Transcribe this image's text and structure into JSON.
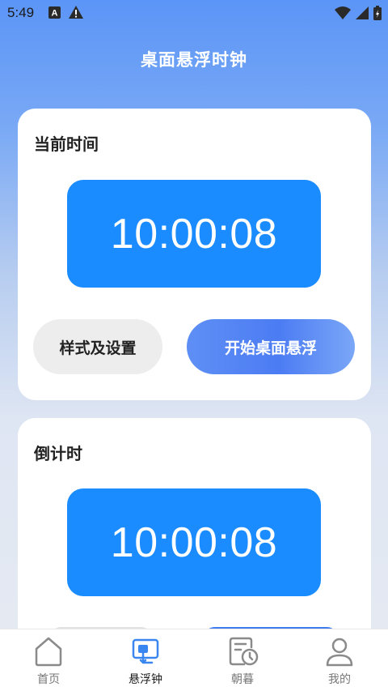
{
  "status_bar": {
    "time": "5:49",
    "left_icons": [
      "a-box-icon",
      "warning-icon"
    ],
    "right_icons": [
      "wifi-icon",
      "signal-icon",
      "battery-icon"
    ]
  },
  "app": {
    "title": "桌面悬浮时钟"
  },
  "current_time_card": {
    "title": "当前时间",
    "time": "10:00:08",
    "style_button": "样式及设置",
    "float_button": "开始桌面悬浮"
  },
  "countdown_card": {
    "title": "倒计时",
    "time": "10:00:08"
  },
  "tab_bar": {
    "tabs": [
      {
        "label": "首页",
        "icon": "home-icon",
        "active": false
      },
      {
        "label": "悬浮钟",
        "icon": "floating-clock-icon",
        "active": true
      },
      {
        "label": "朝暮",
        "icon": "calendar-clock-icon",
        "active": false
      },
      {
        "label": "我的",
        "icon": "profile-icon",
        "active": false
      }
    ]
  },
  "colors": {
    "clock_box": "#1a8cff",
    "accent_blue": "#4c7cf3",
    "tab_active": "#3a86f0",
    "tab_inactive": "#8a8a8a"
  }
}
